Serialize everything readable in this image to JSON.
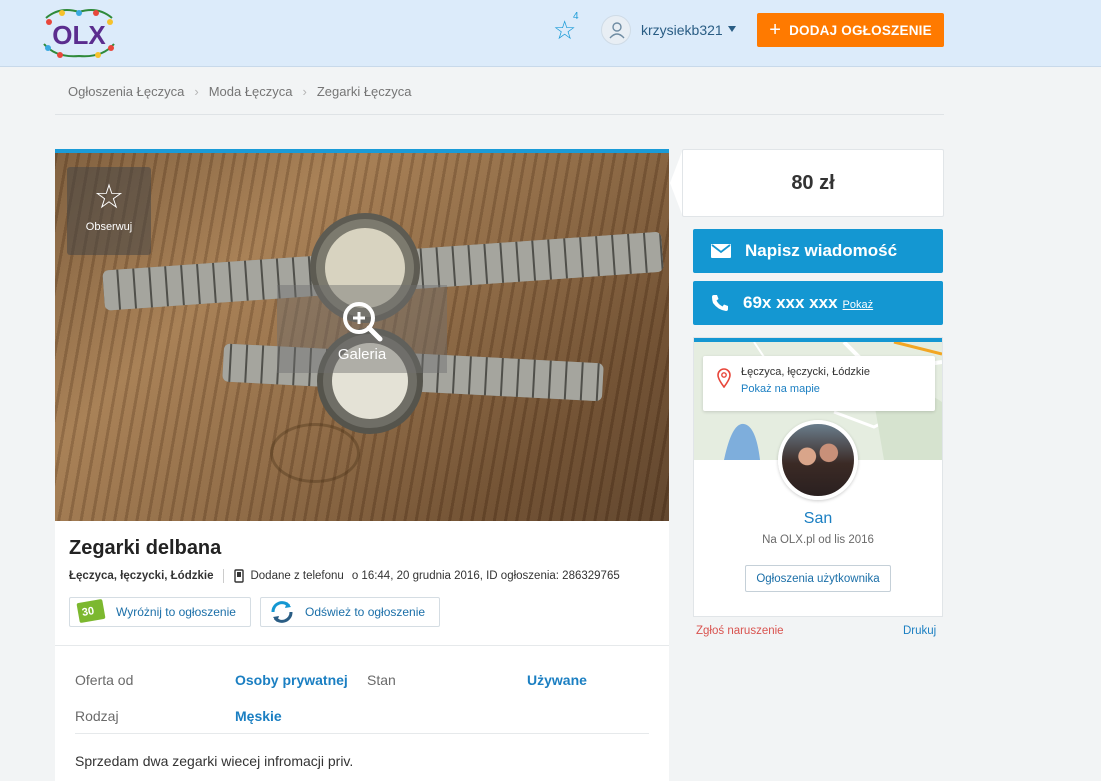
{
  "header": {
    "logo_text": "OLX",
    "favorites_count": "4",
    "username": "krzysiekb321",
    "add_button_label": "DODAJ OGŁOSZENIE"
  },
  "breadcrumb": [
    "Ogłoszenia Łęczyca",
    "Moda Łęczyca",
    "Zegarki Łęczyca"
  ],
  "listing": {
    "observe_label": "Obserwuj",
    "gallery_label": "Galeria",
    "title": "Zegarki delbana",
    "location": "Łęczyca, łęczycki, Łódzkie",
    "added_via": "Dodane z telefonu",
    "added_info": "o 16:44, 20 grudnia 2016, ID ogłoszenia: 286329765",
    "promote_label": "Wyróżnij to ogłoszenie",
    "promote_badge": "30",
    "refresh_label": "Odśwież to ogłoszenie",
    "params": [
      {
        "label": "Oferta od",
        "value": "Osoby prywatnej"
      },
      {
        "label": "Stan",
        "value": "Używane"
      },
      {
        "label": "Rodzaj",
        "value": "Męskie"
      }
    ],
    "description": "Sprzedam dwa zegarki wiecej infromacji priv."
  },
  "sidebar": {
    "price": "80 zł",
    "message_button": "Napisz wiadomość",
    "phone_masked": "69x xxx xxx",
    "phone_show": "Pokaż",
    "map_address": "Łęczyca, łęczycki, Łódzkie",
    "map_link": "Pokaż na mapie",
    "seller_name": "San",
    "seller_since": "Na OLX.pl od lis 2016",
    "user_ads_button": "Ogłoszenia użytkownika",
    "report_link": "Zgłoś naruszenie",
    "print_link": "Drukuj"
  },
  "colors": {
    "header_bg": "#dcebfa",
    "accent_blue": "#1497d2",
    "add_button": "#ff7a00",
    "report_red": "#d9534f"
  }
}
